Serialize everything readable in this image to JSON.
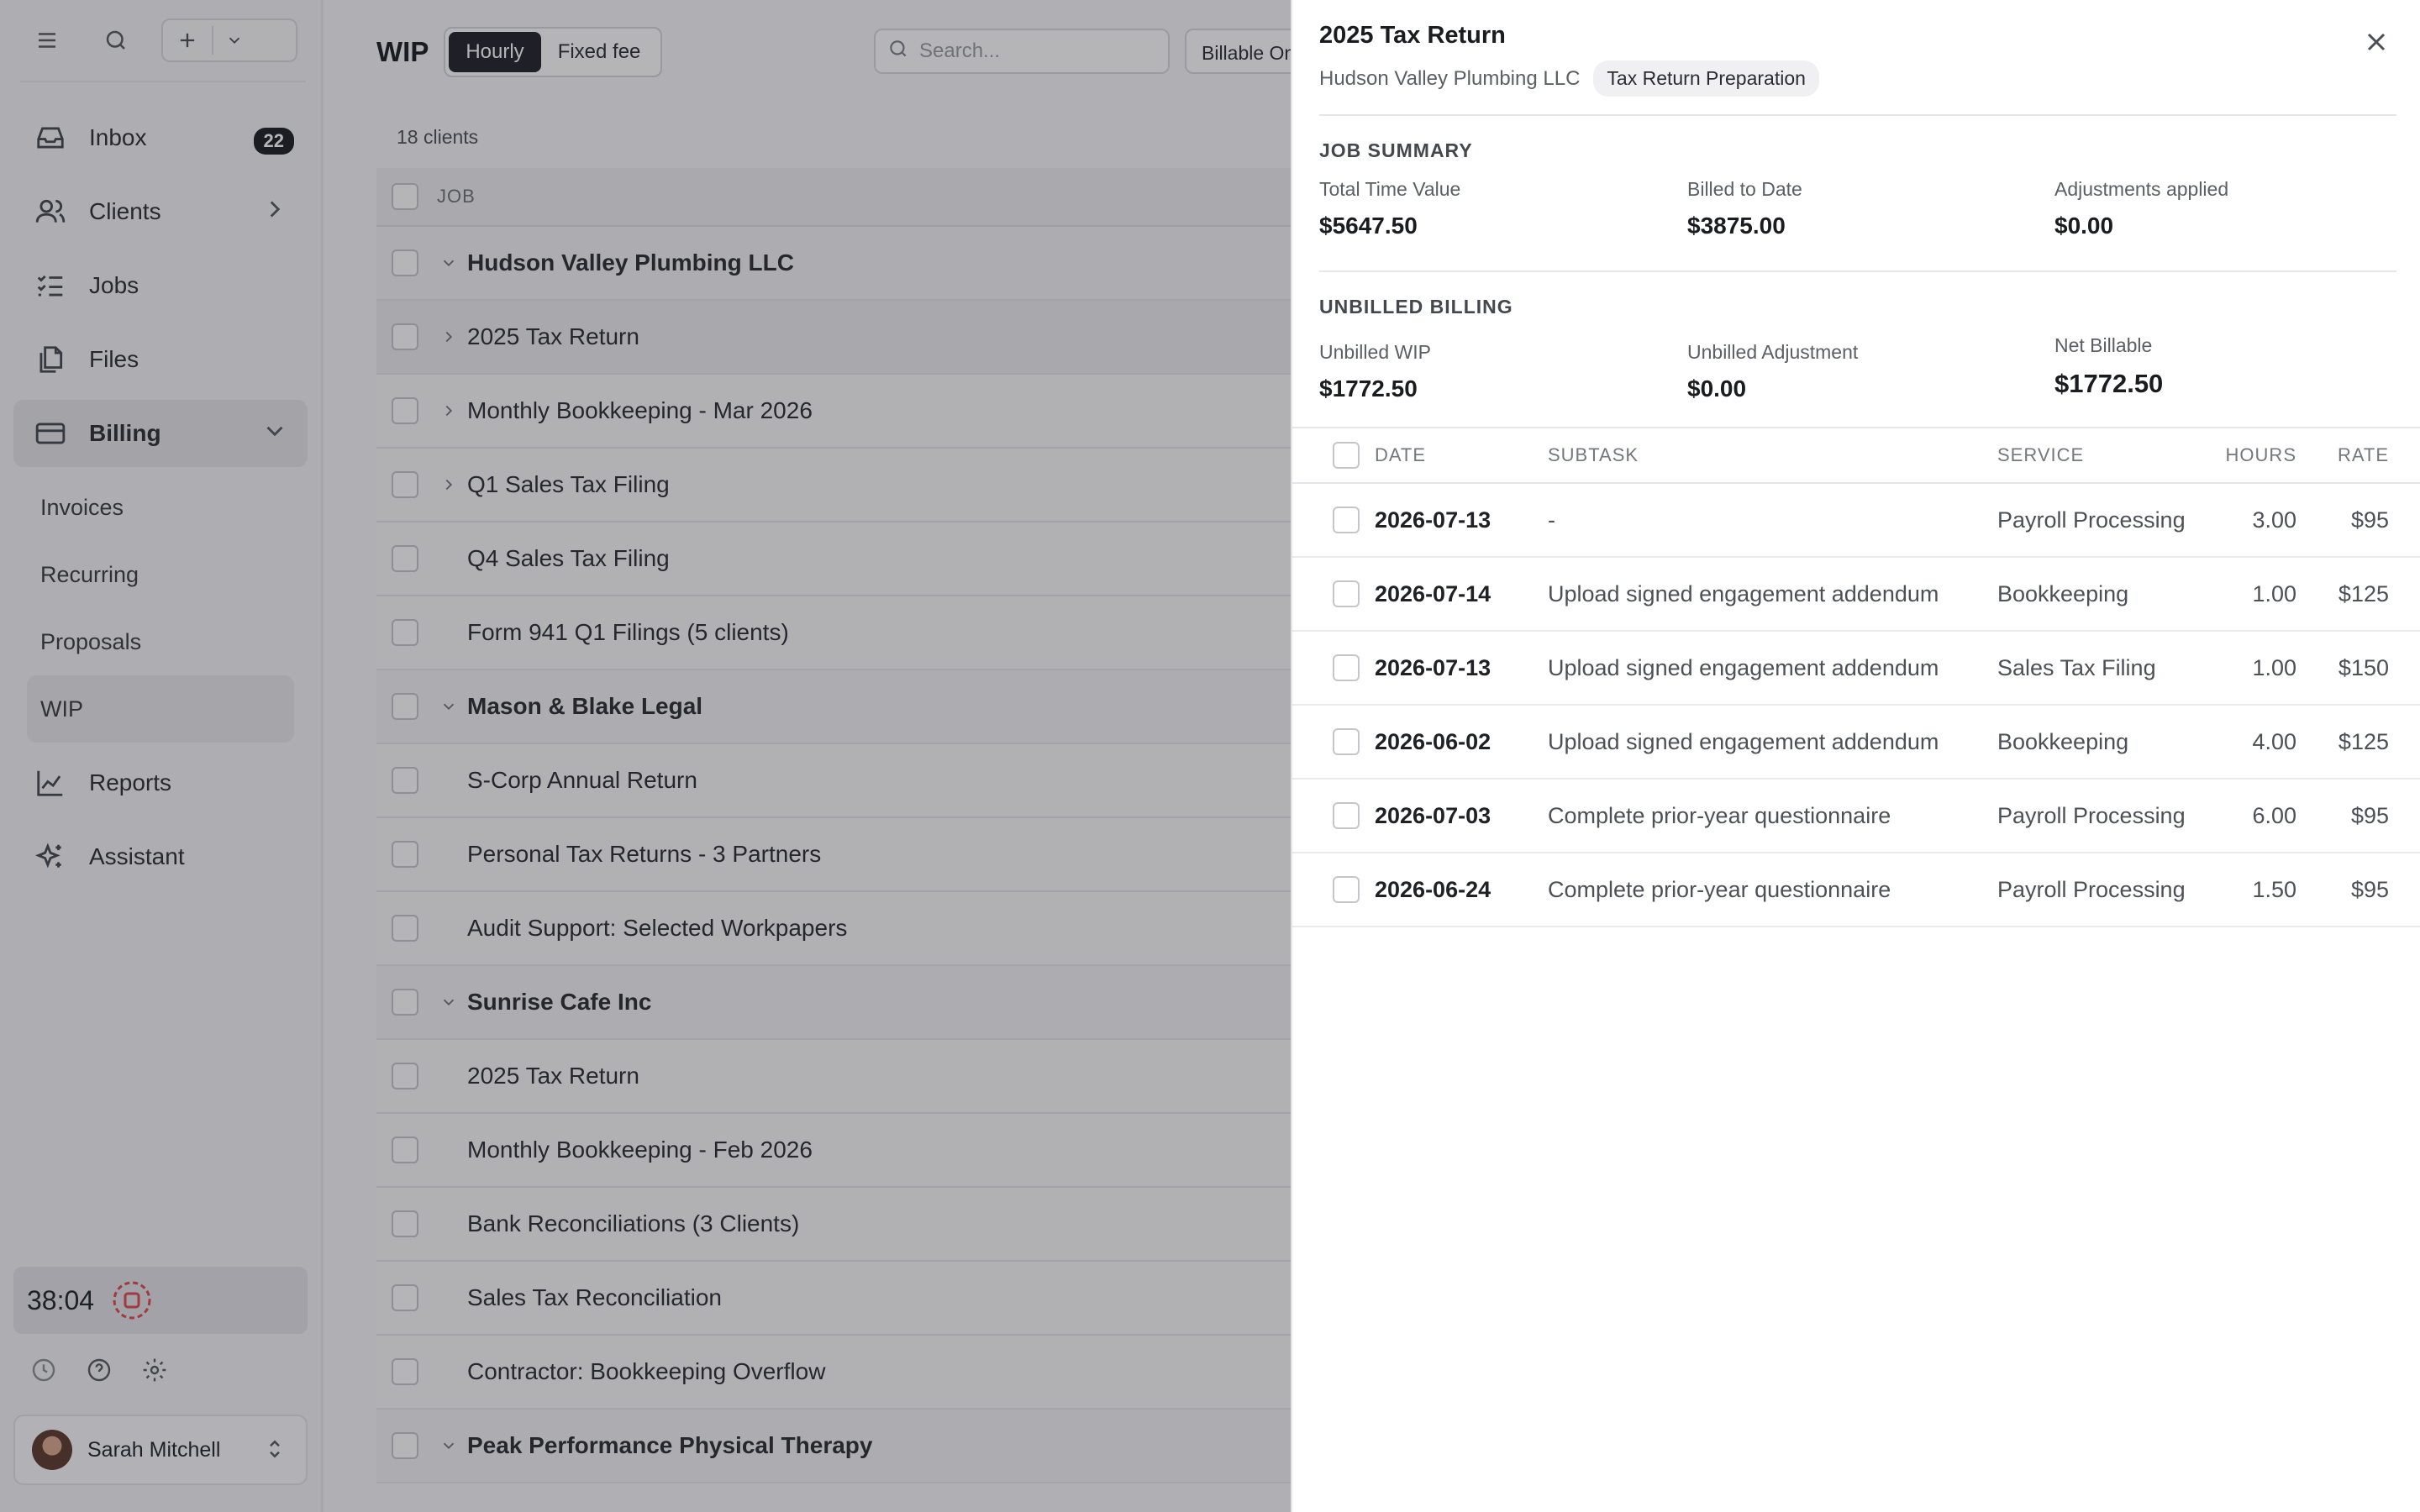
{
  "sidebar": {
    "nav": [
      {
        "label": "Inbox",
        "icon": "inbox-icon",
        "badge": "22"
      },
      {
        "label": "Clients",
        "icon": "users-icon"
      },
      {
        "label": "Jobs",
        "icon": "list-check-icon"
      },
      {
        "label": "Files",
        "icon": "files-icon"
      },
      {
        "label": "Billing",
        "icon": "credit-card-icon"
      }
    ],
    "billing_sub": [
      "Invoices",
      "Recurring",
      "Proposals",
      "WIP"
    ],
    "nav_bottom": [
      {
        "label": "Reports",
        "icon": "chart-line-icon"
      },
      {
        "label": "Assistant",
        "icon": "sparkles-icon"
      }
    ],
    "timer": "38:04",
    "user_name": "Sarah Mitchell"
  },
  "main": {
    "title": "WIP",
    "segments": [
      "Hourly",
      "Fixed fee"
    ],
    "search_placeholder": "Search...",
    "filter_label": "Billable Only",
    "client_count": "18 clients",
    "column_job": "JOB",
    "rows": [
      {
        "label": "Hudson Valley Plumbing LLC",
        "type": "group"
      },
      {
        "label": "2025 Tax Return",
        "type": "job",
        "expandable": true
      },
      {
        "label": "Monthly Bookkeeping - Mar 2026",
        "type": "job",
        "expandable": true
      },
      {
        "label": "Q1 Sales Tax Filing",
        "type": "job",
        "expandable": true
      },
      {
        "label": "Q4 Sales Tax Filing",
        "type": "job"
      },
      {
        "label": "Form 941 Q1 Filings (5 clients)",
        "type": "job"
      },
      {
        "label": "Mason & Blake Legal",
        "type": "group"
      },
      {
        "label": "S-Corp Annual Return",
        "type": "job"
      },
      {
        "label": "Personal Tax Returns - 3 Partners",
        "type": "job"
      },
      {
        "label": "Audit Support: Selected Workpapers",
        "type": "job"
      },
      {
        "label": "Sunrise Cafe Inc",
        "type": "group"
      },
      {
        "label": "2025 Tax Return",
        "type": "job"
      },
      {
        "label": "Monthly Bookkeeping - Feb 2026",
        "type": "job"
      },
      {
        "label": "Bank Reconciliations (3 Clients)",
        "type": "job"
      },
      {
        "label": "Sales Tax Reconciliation",
        "type": "job"
      },
      {
        "label": "Contractor: Bookkeeping Overflow",
        "type": "job"
      },
      {
        "label": "Peak Performance Physical Therapy",
        "type": "group"
      }
    ]
  },
  "drawer": {
    "title": "2025 Tax Return",
    "client": "Hudson Valley Plumbing LLC",
    "tag": "Tax Return Preparation",
    "job_summary": {
      "label": "JOB SUMMARY",
      "items": [
        {
          "k": "Total Time Value",
          "v": "$5647.50"
        },
        {
          "k": "Billed to Date",
          "v": "$3875.00"
        },
        {
          "k": "Adjustments applied",
          "v": "$0.00"
        }
      ]
    },
    "unbilled": {
      "label": "UNBILLED BILLING",
      "items": [
        {
          "k": "Unbilled WIP",
          "v": "$1772.50"
        },
        {
          "k": "Unbilled Adjustment",
          "v": "$0.00"
        },
        {
          "k": "Net Billable",
          "v": "$1772.50"
        }
      ]
    },
    "columns": [
      "DATE",
      "SUBTASK",
      "SERVICE",
      "HOURS",
      "RATE"
    ],
    "entries": [
      {
        "date": "2026-07-13",
        "subtask": "-",
        "service": "Payroll Processing",
        "hours": "3.00",
        "rate": "$95"
      },
      {
        "date": "2026-07-14",
        "subtask": "Upload signed engagement addendum",
        "service": "Bookkeeping",
        "hours": "1.00",
        "rate": "$125"
      },
      {
        "date": "2026-07-13",
        "subtask": "Upload signed engagement addendum",
        "service": "Sales Tax Filing",
        "hours": "1.00",
        "rate": "$150"
      },
      {
        "date": "2026-06-02",
        "subtask": "Upload signed engagement addendum",
        "service": "Bookkeeping",
        "hours": "4.00",
        "rate": "$125"
      },
      {
        "date": "2026-07-03",
        "subtask": "Complete prior-year questionnaire",
        "service": "Payroll Processing",
        "hours": "6.00",
        "rate": "$95"
      },
      {
        "date": "2026-06-24",
        "subtask": "Complete prior-year questionnaire",
        "service": "Payroll Processing",
        "hours": "1.50",
        "rate": "$95"
      }
    ]
  },
  "colors": {
    "accent_dark": "#1e2028",
    "overlay": "rgba(30,30,40,0.33)",
    "recording_red": "#e04848"
  }
}
